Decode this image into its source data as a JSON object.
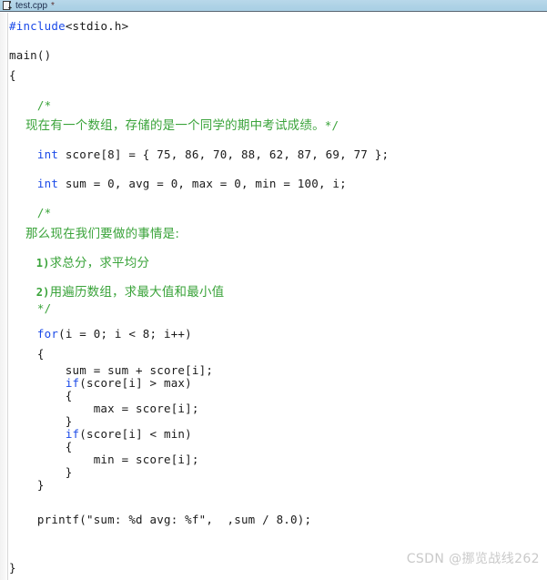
{
  "window": {
    "tab": {
      "icon": "cpp-file-icon",
      "label": "test.cpp",
      "dirty_marker": "*"
    }
  },
  "editor": {
    "language": "C++",
    "colors": {
      "keyword": "#1b4ae8",
      "comment": "#3aa33a",
      "text": "#1a1a1a",
      "background": "#ffffff",
      "tabbar": "#aed2e6",
      "gutter": "#f5f5f5"
    },
    "lines": [
      {
        "kind": "code",
        "segments": [
          {
            "style": "kw",
            "text": "#include"
          },
          {
            "style": "txt",
            "text": "<stdio.h>"
          }
        ]
      },
      {
        "kind": "blank",
        "segments": []
      },
      {
        "kind": "code",
        "segments": [
          {
            "style": "txt",
            "text": "main()"
          }
        ]
      },
      {
        "kind": "code",
        "segments": [
          {
            "style": "txt",
            "text": "{"
          }
        ]
      },
      {
        "kind": "blank",
        "segments": []
      },
      {
        "kind": "code",
        "segments": [
          {
            "style": "cm",
            "text": "    /*"
          }
        ]
      },
      {
        "kind": "code",
        "segments": [
          {
            "style": "cmcjk",
            "text": "    现在有一个数组，存储的是一个同学的期中考试成绩。"
          },
          {
            "style": "cm",
            "text": "*/"
          }
        ]
      },
      {
        "kind": "blank",
        "segments": []
      },
      {
        "kind": "code",
        "segments": [
          {
            "style": "txt",
            "text": "    "
          },
          {
            "style": "kw",
            "text": "int"
          },
          {
            "style": "txt",
            "text": " score[8] = { 75, 86, 70, 88, 62, 87, 69, 77 };"
          }
        ]
      },
      {
        "kind": "blank",
        "segments": []
      },
      {
        "kind": "code",
        "segments": [
          {
            "style": "txt",
            "text": "    "
          },
          {
            "style": "kw",
            "text": "int"
          },
          {
            "style": "txt",
            "text": " sum = 0, avg = 0, max = 0, min = 100, i;"
          }
        ]
      },
      {
        "kind": "blank",
        "segments": []
      },
      {
        "kind": "code",
        "segments": [
          {
            "style": "cm",
            "text": "    /*"
          }
        ]
      },
      {
        "kind": "code",
        "segments": [
          {
            "style": "cmcjk",
            "text": "    那么现在我们要做的事情是:"
          }
        ]
      },
      {
        "kind": "blank",
        "segments": []
      },
      {
        "kind": "code",
        "segments": [
          {
            "style": "cmnum",
            "text": "    1)"
          },
          {
            "style": "cmcjk",
            "text": "求总分，求平均分"
          }
        ]
      },
      {
        "kind": "blank",
        "segments": []
      },
      {
        "kind": "code",
        "segments": [
          {
            "style": "cmnum",
            "text": "    2)"
          },
          {
            "style": "cmcjk",
            "text": "用遍历数组，求最大值和最小值"
          }
        ]
      },
      {
        "kind": "tight",
        "segments": [
          {
            "style": "cm",
            "text": "    */"
          }
        ]
      },
      {
        "kind": "blank",
        "segments": []
      },
      {
        "kind": "code",
        "segments": [
          {
            "style": "txt",
            "text": "    "
          },
          {
            "style": "kw",
            "text": "for"
          },
          {
            "style": "txt",
            "text": "(i = 0; i < 8; i++)"
          }
        ]
      },
      {
        "kind": "code",
        "segments": [
          {
            "style": "txt",
            "text": "    {"
          }
        ]
      },
      {
        "kind": "tight",
        "segments": [
          {
            "style": "txt",
            "text": "        sum = sum + score[i];"
          }
        ]
      },
      {
        "kind": "tight",
        "segments": [
          {
            "style": "txt",
            "text": "        "
          },
          {
            "style": "kw",
            "text": "if"
          },
          {
            "style": "txt",
            "text": "(score[i] > max)"
          }
        ]
      },
      {
        "kind": "tight",
        "segments": [
          {
            "style": "txt",
            "text": "        {"
          }
        ]
      },
      {
        "kind": "tight",
        "segments": [
          {
            "style": "txt",
            "text": "            max = score[i];"
          }
        ]
      },
      {
        "kind": "tight",
        "segments": [
          {
            "style": "txt",
            "text": "        }"
          }
        ]
      },
      {
        "kind": "tight",
        "segments": [
          {
            "style": "txt",
            "text": "        "
          },
          {
            "style": "kw",
            "text": "if"
          },
          {
            "style": "txt",
            "text": "(score[i] < min)"
          }
        ]
      },
      {
        "kind": "tight",
        "segments": [
          {
            "style": "txt",
            "text": "        {"
          }
        ]
      },
      {
        "kind": "tight",
        "segments": [
          {
            "style": "txt",
            "text": "            min = score[i];"
          }
        ]
      },
      {
        "kind": "tight",
        "segments": [
          {
            "style": "txt",
            "text": "        }"
          }
        ]
      },
      {
        "kind": "tight",
        "segments": [
          {
            "style": "txt",
            "text": "    }"
          }
        ]
      },
      {
        "kind": "blank",
        "segments": []
      },
      {
        "kind": "blank",
        "segments": []
      },
      {
        "kind": "code",
        "segments": [
          {
            "style": "txt",
            "text": "    printf(\"sum: %d avg: %f\",  ,sum / 8.0);"
          }
        ]
      },
      {
        "kind": "blank",
        "segments": []
      },
      {
        "kind": "blank",
        "segments": []
      },
      {
        "kind": "blank",
        "segments": []
      },
      {
        "kind": "code",
        "segments": [
          {
            "style": "txt",
            "text": "}"
          }
        ]
      }
    ]
  },
  "watermark": {
    "text": "CSDN @挪览战线262"
  }
}
